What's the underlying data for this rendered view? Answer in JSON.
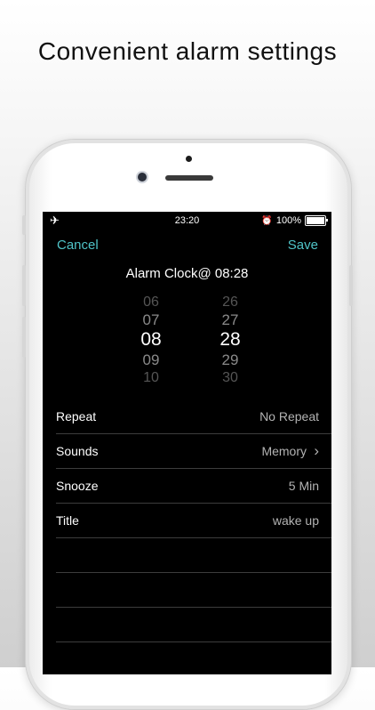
{
  "headline": "Convenient alarm settings",
  "status_bar": {
    "time": "23:20",
    "battery": "100%",
    "battery_level": 1.0,
    "left_icon": "airplane-icon",
    "right_icon": "alarm-icon"
  },
  "nav": {
    "cancel_label": "Cancel",
    "save_label": "Save"
  },
  "title": "Alarm Clock@ 08:28",
  "picker": {
    "hours": [
      "06",
      "07",
      "08",
      "09",
      "10"
    ],
    "minutes": [
      "26",
      "27",
      "28",
      "29",
      "30"
    ],
    "selected_hour": "08",
    "selected_minute": "28"
  },
  "settings": [
    {
      "label": "Repeat",
      "value": "No Repeat"
    },
    {
      "label": "Sounds",
      "value": "Memory"
    },
    {
      "label": "Snooze",
      "value": "5 Min"
    },
    {
      "label": "Title",
      "value": "wake up"
    }
  ],
  "colors": {
    "accent": "#4fc3c7",
    "screen_bg": "#000000",
    "separator": "#3d3d3d"
  }
}
